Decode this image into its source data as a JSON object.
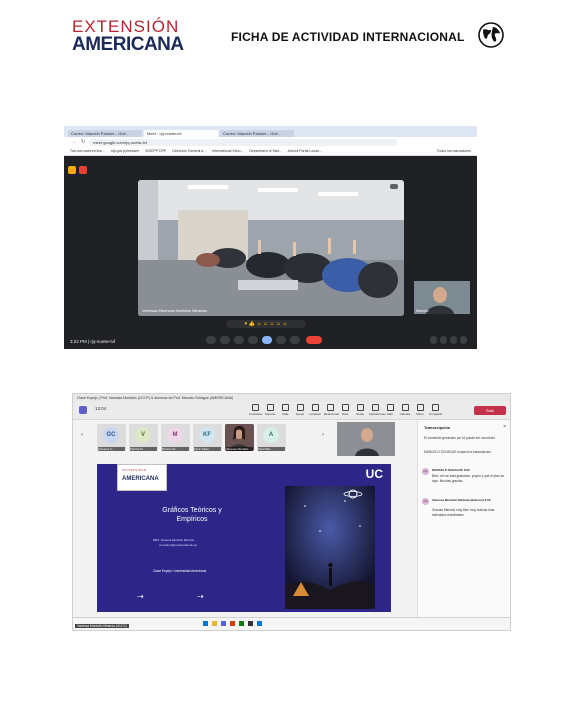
{
  "header": {
    "logo_line1": "EXTENSIÓN",
    "logo_line2": "AMERICANA",
    "title": "FICHA DE ACTIVIDAD INTERNACIONAL"
  },
  "shot1": {
    "tabs": [
      "Correo: Marcelo Pastore - Outl...",
      "Meet - rjq-nuetw-tvf",
      "Correo: Marcelo Pastore - Outl..."
    ],
    "url": "meet.google.com/rjq-nuetw-tvf",
    "bookmarks": [
      "Two-toe.www.en line...",
      "sfp.gov.py/besser/",
      "SIGEPP DPP",
      "Dirección General d...",
      "International Scho...",
      "Department of Stat...",
      "Alumni Portal Londo...",
      "Todos los marcadores"
    ],
    "presenter_label": "Vanessa Eleonora Montaño Miranda",
    "self_label": "Marcelo",
    "meeting_time": "3:22 PM | rjq-nuetw-tvf"
  },
  "shot2": {
    "window_title": "Clase Espejo | Prof. Vanessa Montaño (UCCP) & alumnos de Prof. Marcelo Schägue (AMERICANA)",
    "clock": "13:04",
    "toolbar_items": [
      "Contactos",
      "Soporte",
      "Chat",
      "Gente",
      "Levantar",
      "Reaccionar",
      "Vista",
      "Notas",
      "Aplicaciones",
      "Más",
      "Cámara",
      "Micro",
      "Compartir"
    ],
    "leave_label": "Salir",
    "participants": [
      {
        "initials": "GC",
        "name": "Giovanni C...",
        "color": "#c9d7ef",
        "fg": "#2d4f8f"
      },
      {
        "initials": "V",
        "name": "Patricia M...",
        "color": "#dce8c8",
        "fg": "#4b6b25"
      },
      {
        "initials": "M",
        "name": "Moreno Mi...",
        "color": "#eed8e8",
        "fg": "#8a3a74"
      },
      {
        "initials": "KF",
        "name": "Kevin Salaz...",
        "color": "#d4e6ef",
        "fg": "#2b6a85"
      },
      {
        "initials": "",
        "name": "Vanessa Montaño",
        "color": "#b04d4d",
        "fg": "#fff"
      },
      {
        "initials": "A",
        "name": "Sara Pilar...",
        "color": "#d7eee9",
        "fg": "#2d7565"
      }
    ],
    "slide": {
      "logo_top": "UNIVERSIDAD",
      "logo_bottom": "AMERICANA",
      "uc": "UC",
      "title": "Gráficos Teóricos y Empíricos",
      "author": "MBA. Vanessa Montaño Miranda",
      "email": "vmontanu@continental.edu.pe",
      "subtitle": "Clase Espejo: Universidad Americana"
    },
    "panel": {
      "title": "Transcripción",
      "notice": "El contenido generado por IA puede ser incorrecto",
      "started": "MARCELO SCHAGUE empezó la transcripción",
      "entries": [
        {
          "initials": "MS",
          "speaker": "MARCELO SCHAGUE 9:02",
          "text": "Bien, ahí se está grabando, propio y que el plan es tuyo. Muchas gracias."
        },
        {
          "initials": "VM",
          "speaker": "Vanessa Montaño Miranda (Externo) 9:02",
          "text": "Gracias Marcelo muy bien muy buenas días estimados estudiantes"
        }
      ]
    },
    "presenter_tag": "Vanessa Montaño Miranda (UUCC)"
  },
  "colors": {
    "brand_red": "#b3262f",
    "brand_navy": "#1c2b5a",
    "slide_bg": "#2d2588"
  }
}
